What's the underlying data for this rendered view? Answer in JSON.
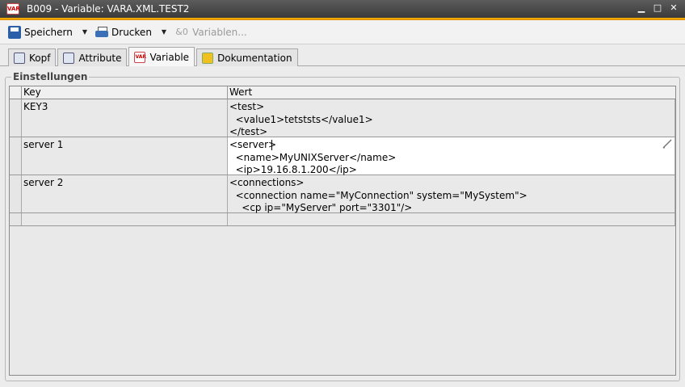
{
  "window": {
    "app_icon": "VAR",
    "title": "B009 - Variable: VARA.XML.TEST2",
    "buttons": [
      "minimize-icon",
      "maximize-icon",
      "close-icon"
    ]
  },
  "toolbar": {
    "save_label": "Speichern",
    "print_label": "Drucken",
    "variables_label": "Variablen..."
  },
  "tabs": [
    {
      "label": "Kopf",
      "icon": "header-icon",
      "active": false
    },
    {
      "label": "Attribute",
      "icon": "attributes-icon",
      "active": false
    },
    {
      "label": "Variable",
      "icon": "variable-icon",
      "active": true
    },
    {
      "label": "Dokumentation",
      "icon": "documentation-icon",
      "active": false
    }
  ],
  "group": {
    "label": "Einstellungen"
  },
  "grid": {
    "columns": [
      "Key",
      "Wert"
    ],
    "rows": [
      {
        "key": "KEY3",
        "value": "<test>\n  <value1>tetststs</value1>\n</test>"
      },
      {
        "key": "server 1",
        "value": "<server>\n  <name>MyUNIXServer</name>\n  <ip>19.16.8.1.200</ip>"
      },
      {
        "key": "server 2",
        "value": "<connections>\n  <connection name=\"MyConnection\" system=\"MySystem\">\n    <cp ip=\"MyServer\" port=\"3301\"/>"
      },
      {
        "key": "",
        "value": ""
      }
    ]
  },
  "colors": {
    "title_accent": "#f4b400",
    "titlebar": "#4a4a4a"
  }
}
